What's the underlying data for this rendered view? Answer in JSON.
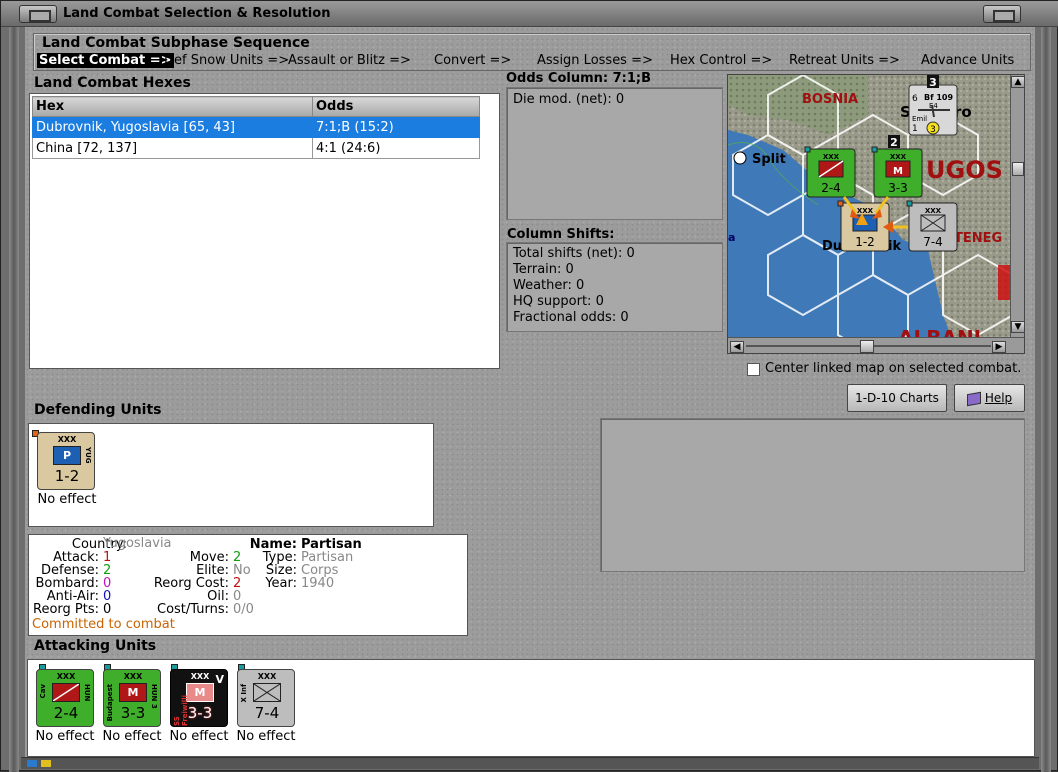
{
  "window": {
    "title": "Land Combat Selection & Resolution"
  },
  "sequence": {
    "title": "Land Combat Subphase Sequence",
    "items": [
      "Select Combat =>",
      "Def Snow Units =>",
      "Assault or Blitz =>",
      "Convert =>",
      "Assign Losses =>",
      "Hex Control =>",
      "Retreat Units =>",
      "Advance Units"
    ]
  },
  "hexes": {
    "title": "Land Combat Hexes",
    "columns": [
      "Hex",
      "Odds"
    ],
    "rows": [
      {
        "hex": "Dubrovnik, Yugoslavia [65, 43]",
        "odds": "7:1;B (15:2)"
      },
      {
        "hex": "China [72, 137]",
        "odds": "4:1 (24:6)"
      }
    ]
  },
  "odds": {
    "title": "Odds Column: 7:1;B",
    "die_mod": "Die mod. (net): 0"
  },
  "shifts": {
    "title": "Column Shifts:",
    "lines": [
      "Total shifts (net): 0",
      "Terrain: 0",
      "Weather: 0",
      "HQ support: 0",
      "Fractional odds: 0"
    ]
  },
  "map": {
    "labels": [
      "BOSNIA",
      "Split",
      "UGOS",
      "Du",
      "ik",
      "TENEG",
      "ALBANI",
      "Sa",
      "ro",
      "a"
    ],
    "counters": [
      {
        "corps": "XXX",
        "strength": "2-4",
        "side": "HUN",
        "lside": "Cav"
      },
      {
        "corps": "XXX",
        "strength": "3-3",
        "side": "HUN",
        "lside": "Bud"
      },
      {
        "corps": "XXX",
        "strength": "1-2",
        "side": "YUG",
        "lside": ""
      },
      {
        "corps": "XXX",
        "strength": "7-4",
        "side": "",
        "lside": "X Inf"
      }
    ],
    "air_unit": {
      "name": "Bf 109",
      "sub": "E4",
      "pilot": "Emil",
      "range": "6",
      "num": "1",
      "badge": "3"
    },
    "stack_numbers": [
      "3",
      "2"
    ]
  },
  "center_link": {
    "label": "Center linked map on selected combat.",
    "checked": false
  },
  "buttons": {
    "charts": "1-D-10 Charts",
    "help": "Help"
  },
  "defending": {
    "title": "Defending Units",
    "units": [
      {
        "corps": "XXX",
        "type_letter": "P",
        "strength": "1-2",
        "side": "YUG",
        "result": "No effect",
        "color": "#d9c8a0"
      }
    ]
  },
  "unit_info": {
    "country_k": "Country:",
    "country_v": "Yugoslavia",
    "attack_k": "Attack:",
    "attack_v": "1",
    "defense_k": "Defense:",
    "defense_v": "2",
    "bombard_k": "Bombard:",
    "bombard_v": "0",
    "antiair_k": "Anti-Air:",
    "antiair_v": "0",
    "reorgpts_k": "Reorg Pts:",
    "reorgpts_v": "0",
    "move_k": "Move:",
    "move_v": "2",
    "elite_k": "Elite:",
    "elite_v": "No",
    "reorgcost_k": "Reorg Cost:",
    "reorgcost_v": "2",
    "oil_k": "Oil:",
    "oil_v": "0",
    "costturns_k": "Cost/Turns:",
    "costturns_v": "0/0",
    "name_k": "Name:",
    "name_v": "Partisan",
    "type_k": "Type:",
    "type_v": "Partisan",
    "size_k": "Size:",
    "size_v": "Corps",
    "year_k": "Year:",
    "year_v": "1940",
    "status": "Committed to combat"
  },
  "attacking": {
    "title": "Attacking Units",
    "units": [
      {
        "corps": "XXX",
        "letter": "",
        "strength": "2-4",
        "side": "HUN",
        "lside": "Cav",
        "result": "No effect"
      },
      {
        "corps": "XXX",
        "letter": "M",
        "strength": "3-3",
        "side": "HUN 3",
        "lside": "Budapest",
        "result": "No effect"
      },
      {
        "corps": "XXX",
        "letter": "M",
        "strength": "3-3",
        "side": "V",
        "lside": "SS Freiwilli",
        "result": "No effect"
      },
      {
        "corps": "XXX",
        "letter": "",
        "strength": "7-4",
        "side": "",
        "lside": "X Inf",
        "result": "No effect"
      }
    ]
  },
  "colors": {
    "selection": "#1c7de0",
    "hun_green": "#3fae2a",
    "ss_black": "#111111",
    "ger_grey": "#bdbdbd",
    "yug_tan": "#d9c8a0",
    "status_orange": "#c86400"
  }
}
